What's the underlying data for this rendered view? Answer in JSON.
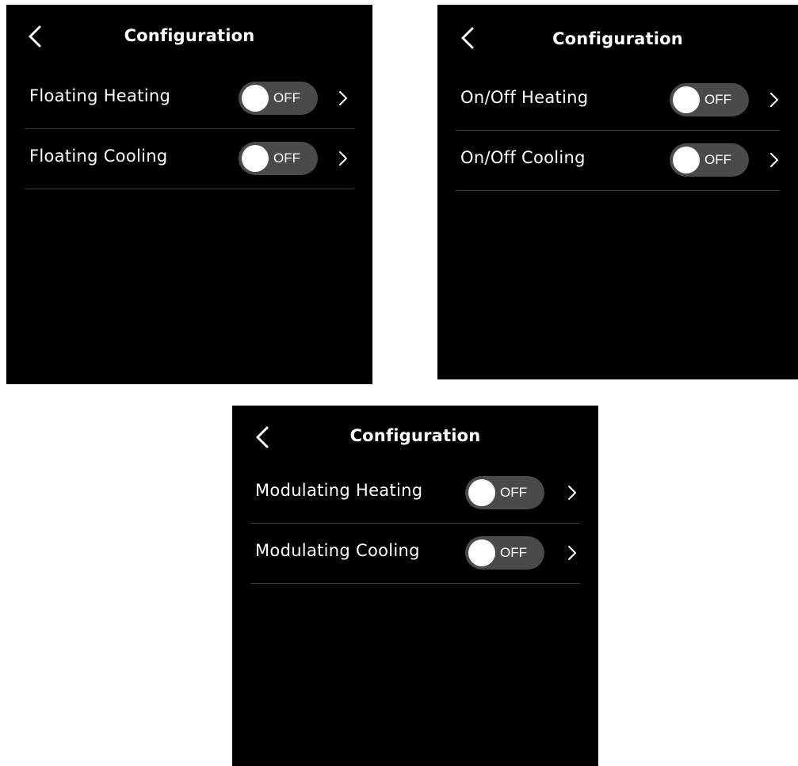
{
  "screens": [
    {
      "title": "Configuration",
      "rows": [
        {
          "label": "Floating Heating",
          "toggle": "OFF"
        },
        {
          "label": "Floating Cooling",
          "toggle": "OFF"
        }
      ]
    },
    {
      "title": "Configuration",
      "rows": [
        {
          "label": "On/Off Heating",
          "toggle": "OFF"
        },
        {
          "label": "On/Off Cooling",
          "toggle": "OFF"
        }
      ]
    },
    {
      "title": "Configuration",
      "rows": [
        {
          "label": "Modulating Heating",
          "toggle": "OFF"
        },
        {
          "label": "Modulating Cooling",
          "toggle": "OFF"
        }
      ]
    }
  ],
  "colors": {
    "screen_background": "#000000",
    "text": "#ffffff",
    "toggle_track": "#4a4a4a",
    "toggle_knob": "#ffffff",
    "divider": "#3a3a3a"
  },
  "icons": {
    "back": "chevron-left-icon",
    "row_arrow": "chevron-right-icon"
  }
}
